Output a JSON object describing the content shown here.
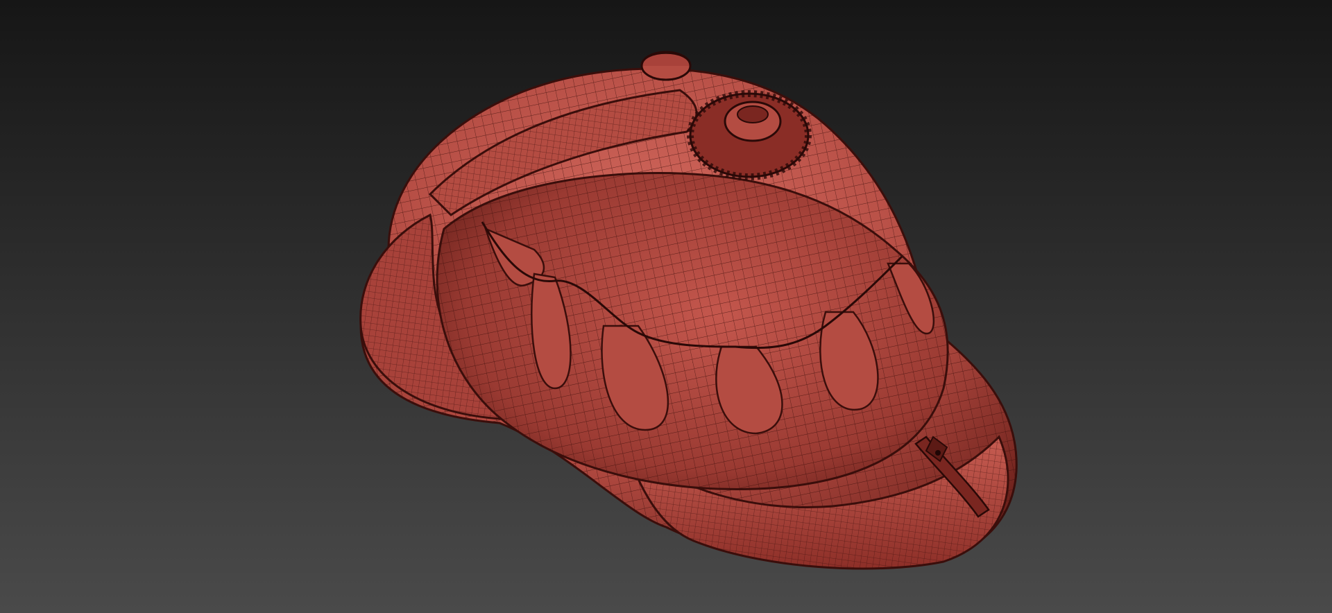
{
  "viewport": {
    "background_top": "#161616",
    "background_bottom": "#4a4a4a"
  },
  "model": {
    "name": "helmet-model",
    "shading": "wireframe-on-shaded",
    "surface_color": "#c0564d",
    "surface_light": "#d96e63",
    "surface_dark": "#7a2620",
    "wire_color": "#3a0e0b"
  }
}
